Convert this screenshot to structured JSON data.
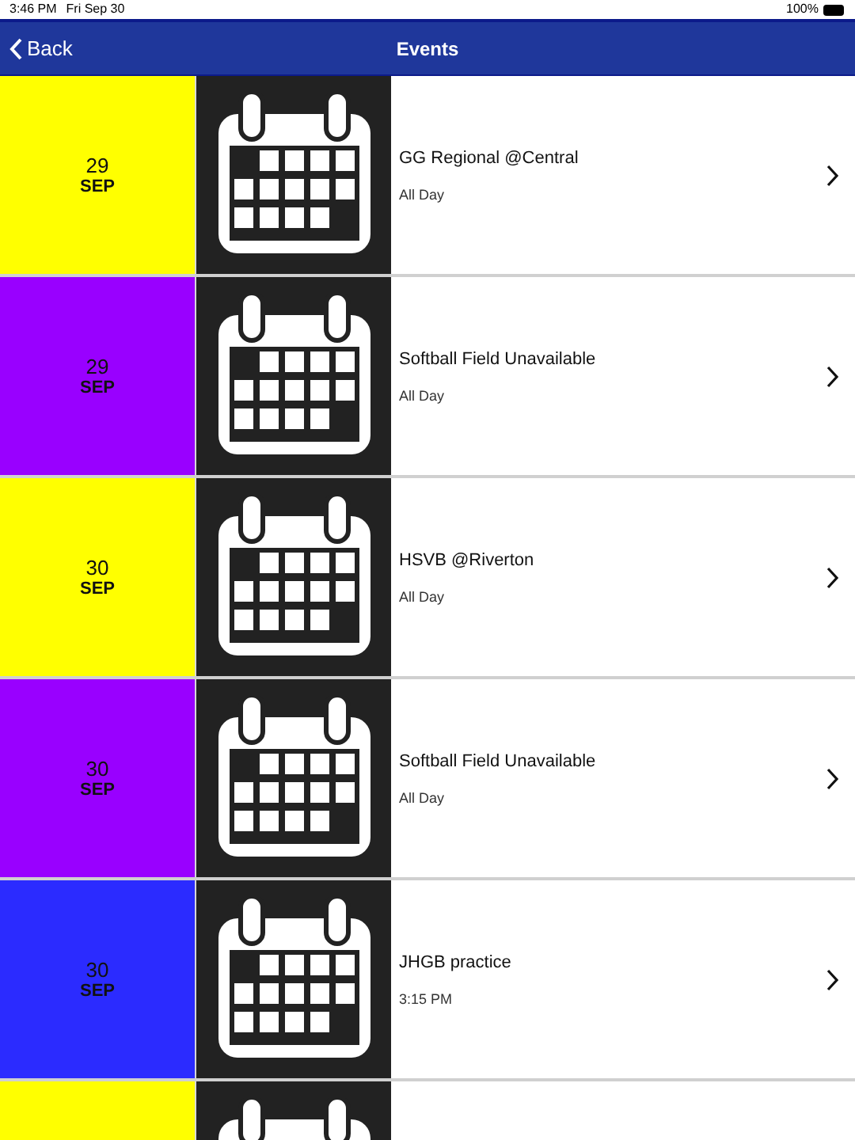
{
  "status_bar": {
    "time": "3:46 PM",
    "date": "Fri Sep 30",
    "battery": "100%"
  },
  "nav": {
    "back": "Back",
    "title": "Events"
  },
  "events": [
    {
      "color": "#ffff00",
      "day": "29",
      "month": "SEP",
      "title": "GG Regional @Central",
      "time": "All Day"
    },
    {
      "color": "#9900ff",
      "day": "29",
      "month": "SEP",
      "title": "Softball Field Unavailable",
      "time": "All Day"
    },
    {
      "color": "#ffff00",
      "day": "30",
      "month": "SEP",
      "title": "HSVB @Riverton",
      "time": "All Day"
    },
    {
      "color": "#9900ff",
      "day": "30",
      "month": "SEP",
      "title": "Softball Field Unavailable",
      "time": "All Day"
    },
    {
      "color": "#2b2bff",
      "day": "30",
      "month": "SEP",
      "title": "JHGB practice",
      "time": "3:15 PM"
    },
    {
      "color": "#ffff00"
    }
  ]
}
